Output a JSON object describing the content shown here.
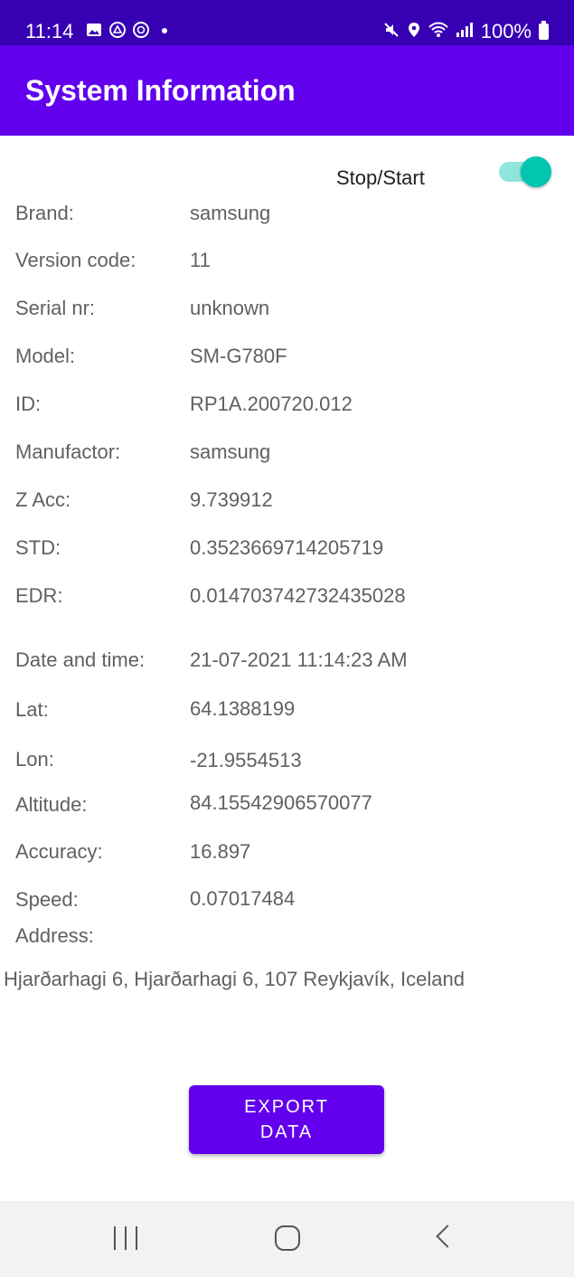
{
  "status_bar": {
    "time": "11:14",
    "left_icons": [
      "gallery-icon",
      "drive-icon",
      "sync-icon",
      "dot-icon"
    ],
    "right_icons": [
      "mute-icon",
      "location-icon",
      "wifi-icon",
      "signal-icon"
    ],
    "battery": "100%"
  },
  "app_bar": {
    "title": "System Information"
  },
  "toggle": {
    "label": "Stop/Start",
    "on": true
  },
  "info": {
    "brand": {
      "label": "Brand:",
      "value": "samsung"
    },
    "version_code": {
      "label": "Version code:",
      "value": "11"
    },
    "serial": {
      "label": "Serial nr:",
      "value": "unknown"
    },
    "model": {
      "label": "Model:",
      "value": "SM-G780F"
    },
    "id": {
      "label": "ID:",
      "value": "RP1A.200720.012"
    },
    "manufactor": {
      "label": "Manufactor:",
      "value": "samsung"
    },
    "z_acc": {
      "label": "Z Acc:",
      "value": "9.739912"
    },
    "std": {
      "label": "STD:",
      "value": "0.3523669714205719"
    },
    "edr": {
      "label": "EDR:",
      "value": "0.014703742732435028"
    },
    "date_time": {
      "label": "Date and time:",
      "value": "21-07-2021 11:14:23 AM"
    },
    "lat": {
      "label": "Lat:",
      "value": "64.1388199"
    },
    "lon": {
      "label": "Lon:",
      "value": "-21.9554513"
    },
    "altitude": {
      "label": "Altitude:",
      "value": "84.15542906570077"
    },
    "accuracy": {
      "label": "Accuracy:",
      "value": "16.897"
    },
    "speed": {
      "label": "Speed:",
      "value": "0.07017484"
    },
    "address": {
      "label": "Address:",
      "value": "Hjarðarhagi 6, Hjarðarhagi 6, 107 Reykjavík, Iceland"
    }
  },
  "export_button": {
    "label": "EXPORT DATA"
  },
  "colors": {
    "status_bar": "#3700b3",
    "app_bar": "#6200ee",
    "switch_thumb": "#03c6b0",
    "switch_track": "#8fe6dc",
    "button": "#6200ee"
  }
}
